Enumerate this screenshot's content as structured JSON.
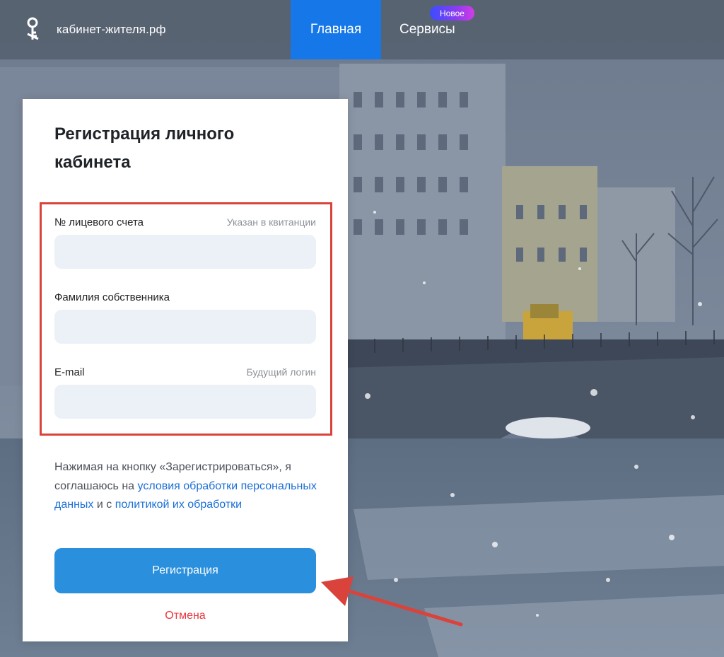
{
  "header": {
    "site_name": "кабинет-жителя.рф",
    "logo_icon": "key-icon",
    "nav": [
      {
        "label": "Главная",
        "active": true
      },
      {
        "label": "Сервисы",
        "active": false,
        "badge": "Новое"
      }
    ],
    "active_color": "#1677e8"
  },
  "form": {
    "title": "Регистрация личного кабинета",
    "fields": [
      {
        "label": "№ лицевого счета",
        "hint": "Указан в квитанции",
        "value": ""
      },
      {
        "label": "Фамилия собственника",
        "hint": "",
        "value": ""
      },
      {
        "label": "E-mail",
        "hint": "Будущий логин",
        "value": ""
      }
    ],
    "consent": {
      "text_1": "Нажимая на кнопку «Зарегистрироваться», я соглашаюсь на ",
      "link_1": "условия обработки персональных данных",
      "text_2": " и с ",
      "link_2": "политикой их обработки"
    },
    "submit_label": "Регистрация",
    "cancel_label": "Отмена"
  },
  "colors": {
    "accent": "#2a8fdc",
    "link": "#1b6fd6",
    "cancel": "#e8373d",
    "annotation": "#d9433b",
    "badge_gradient_start": "#3a4dff",
    "badge_gradient_end": "#d23ce6"
  }
}
